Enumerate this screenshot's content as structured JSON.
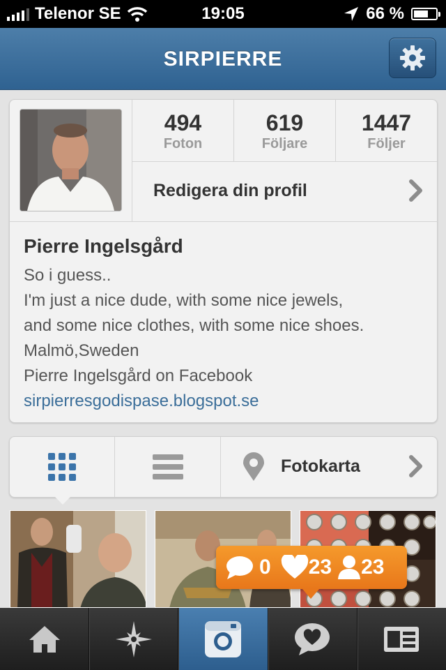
{
  "status_bar": {
    "carrier": "Telenor SE",
    "time": "19:05",
    "battery": "66 %",
    "battery_level": 0.66
  },
  "nav": {
    "title": "SIRPIERRE",
    "settings_icon": "gear-icon"
  },
  "profile": {
    "stats": [
      {
        "value": "494",
        "label": "Foton"
      },
      {
        "value": "619",
        "label": "Följare"
      },
      {
        "value": "1447",
        "label": "Följer"
      }
    ],
    "edit_label": "Redigera din profil",
    "name": "Pierre Ingelsgård",
    "bio_lines": [
      "So i guess..",
      "I'm just a nice dude, with some nice jewels,",
      "and some nice clothes, with some nice shoes.",
      "Malmö,Sweden",
      "Pierre Ingelsgård on Facebook"
    ],
    "website": "sirpierresgodispase.blogspot.se"
  },
  "view_toggle": {
    "active": "grid",
    "map_label": "Fotokarta"
  },
  "notifications": {
    "comments": "0",
    "likes": "23",
    "followers": "23"
  },
  "tab_bar": {
    "active": "camera",
    "tabs": [
      "home-icon",
      "explore-star-icon",
      "camera-icon",
      "activity-heart-icon",
      "profile-card-icon"
    ]
  },
  "colors": {
    "nav_blue": "#3a6d9a",
    "link_blue": "#3b6e99",
    "notif_orange": "#f08a24"
  }
}
